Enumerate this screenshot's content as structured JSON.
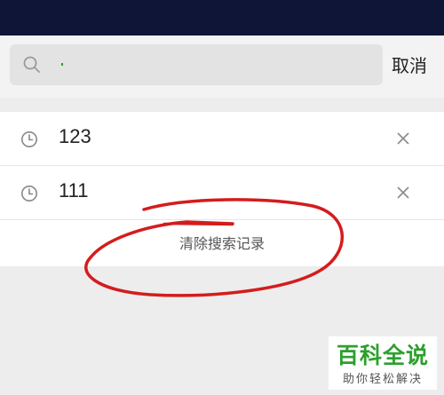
{
  "search": {
    "placeholder": "",
    "value": "",
    "cancel_label": "取消"
  },
  "history": {
    "items": [
      {
        "label": "123"
      },
      {
        "label": "111"
      }
    ],
    "clear_label": "清除搜索记录"
  },
  "watermark": {
    "title": "百科全说",
    "subtitle": "助你轻松解决"
  },
  "colors": {
    "topbar": "#0e1536",
    "annotation": "#d41c1c",
    "watermark_green": "#2ca02c"
  }
}
